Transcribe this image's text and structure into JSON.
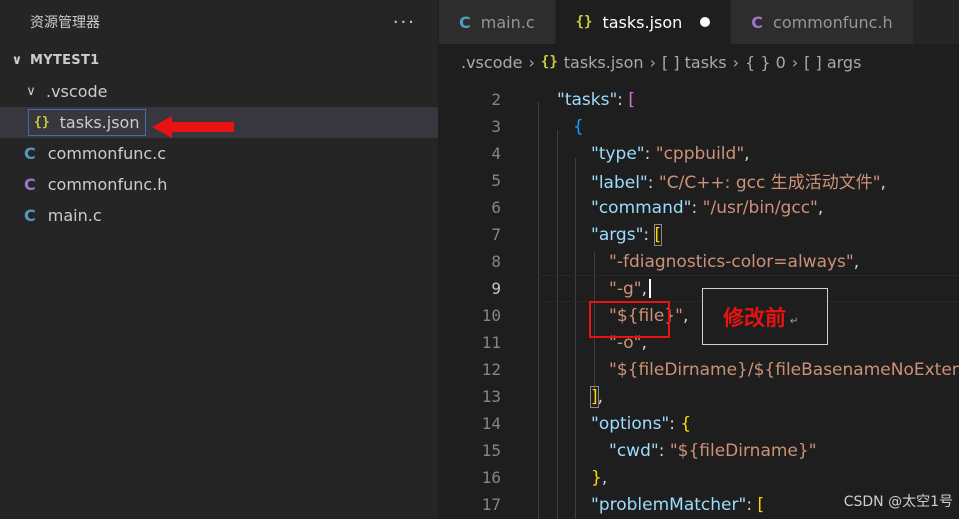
{
  "sidebar": {
    "title": "资源管理器",
    "more_label": "···",
    "project": "MYTEST1",
    "items": [
      {
        "label": ".vscode",
        "icon": "chevron-down-icon"
      },
      {
        "label": "tasks.json",
        "icon": "json-braces-icon",
        "glyph": "{}"
      },
      {
        "label": "commonfunc.c",
        "icon": "c-file-icon",
        "glyph": "C"
      },
      {
        "label": "commonfunc.h",
        "icon": "c-header-icon",
        "glyph": "C"
      },
      {
        "label": "main.c",
        "icon": "c-file-icon",
        "glyph": "C"
      }
    ]
  },
  "tabs": [
    {
      "label": "main.c",
      "glyph": "C"
    },
    {
      "label": "tasks.json",
      "glyph": "{}",
      "modified": true
    },
    {
      "label": "commonfunc.h",
      "glyph": "C"
    }
  ],
  "breadcrumb": [
    ".vscode",
    "tasks.json",
    "[ ] tasks",
    "{ } 0",
    "[ ] args"
  ],
  "code": {
    "line_numbers": [
      "2",
      "3",
      "4",
      "5",
      "6",
      "7",
      "8",
      "9",
      "10",
      "11",
      "12",
      "13",
      "14",
      "15",
      "16",
      "17"
    ],
    "current_line": "9",
    "tasks_key": "\"tasks\"",
    "type_key": "\"type\"",
    "type_val": "\"cppbuild\"",
    "label_key": "\"label\"",
    "label_val": "\"C/C++: gcc 生成活动文件\"",
    "command_key": "\"command\"",
    "command_val": "\"/usr/bin/gcc\"",
    "args_key": "\"args\"",
    "arg1": "\"-fdiagnostics-color=always\"",
    "arg2": "\"-g\"",
    "arg3": "\"${file}\"",
    "arg4": "\"-o\"",
    "arg5": "\"${fileDirname}/${fileBasenameNoExtension}\"",
    "options_key": "\"options\"",
    "cwd_key": "\"cwd\"",
    "cwd_val": "\"${fileDirname}\"",
    "problem_key": "\"problemMatcher\""
  },
  "annotation": {
    "text": "修改前",
    "mark": "↵"
  },
  "watermark": "CSDN @太空1号",
  "colors": {
    "highlight_red": "#e81212",
    "json_icon": "#cbcb41",
    "c_icon": "#519aba",
    "h_icon": "#a074c4"
  }
}
